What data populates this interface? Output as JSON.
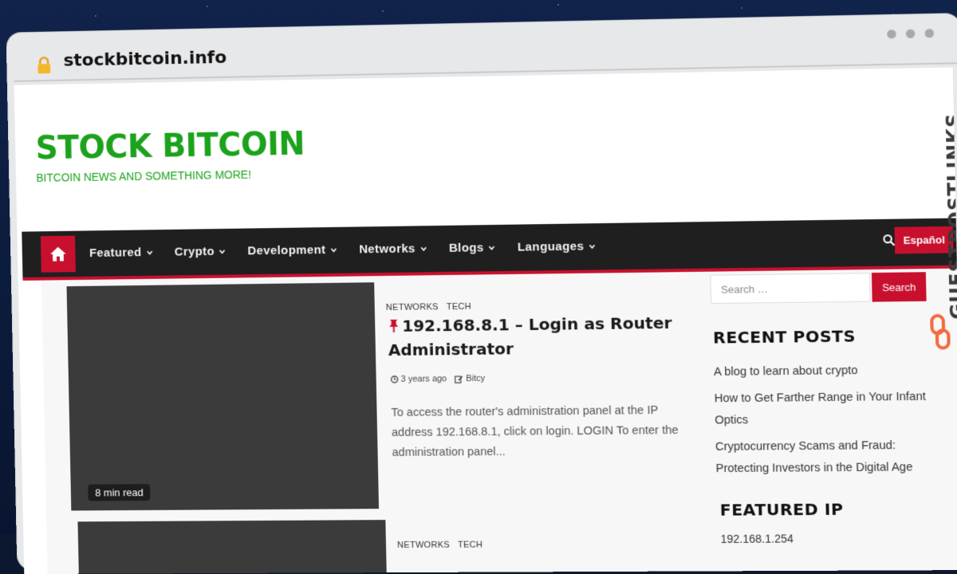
{
  "browser": {
    "url": "stockbitcoin.info"
  },
  "site": {
    "title": "STOCK BITCOIN",
    "tagline": "BITCOIN NEWS AND SOMETHING MORE!",
    "accent_color": "#1ca21c",
    "brand_color": "#c8102e"
  },
  "nav": {
    "items": [
      {
        "label": "Featured"
      },
      {
        "label": "Crypto"
      },
      {
        "label": "Development"
      },
      {
        "label": "Networks"
      },
      {
        "label": "Blogs"
      },
      {
        "label": "Languages"
      }
    ],
    "language_button": "Español"
  },
  "posts": [
    {
      "categories": [
        "NETWORKS",
        "TECH"
      ],
      "title": "192.168.8.1 – Login as Router Administrator",
      "time": "3 years ago",
      "author": "Bitcy",
      "excerpt": "To access the router's administration panel at the IP address 192.168.8.1, click on login. LOGIN To enter the administration panel...",
      "read_time": "8 min read"
    },
    {
      "categories": [
        "NETWORKS",
        "TECH"
      ]
    }
  ],
  "sidebar": {
    "search_placeholder": "Search …",
    "search_button": "Search",
    "recent_title": "RECENT POSTS",
    "recent_posts": [
      "A blog to learn about crypto",
      "How to Get Farther Range in Your Infant Optics",
      "Cryptocurrency Scams and Fraud: Protecting Investors in the Digital Age"
    ],
    "featured_title": "FEATURED IP",
    "featured_ips": [
      "192.168.1.254"
    ]
  },
  "watermark": {
    "text": "GUESTPOSTLINKS"
  }
}
